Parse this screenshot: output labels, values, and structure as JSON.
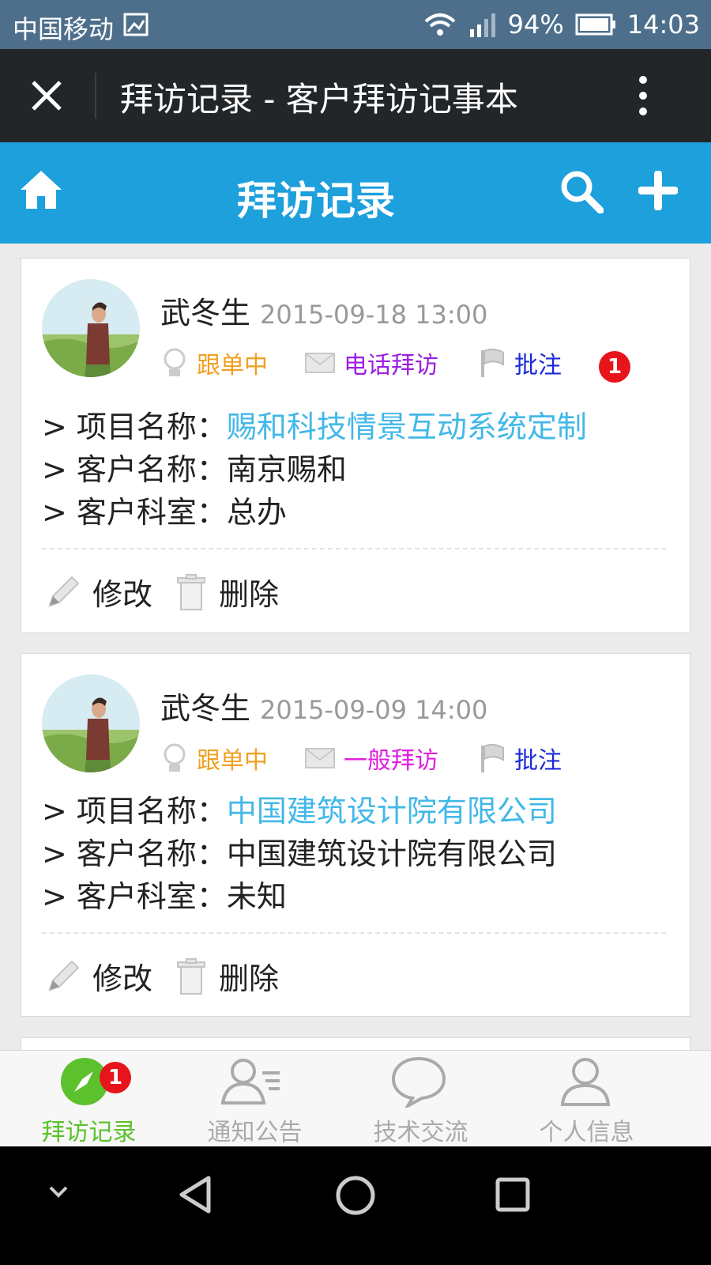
{
  "status_bar": {
    "carrier": "中国移动",
    "battery": "94%",
    "time": "14:03"
  },
  "top_bar": {
    "title": "拜访记录 - 客户拜访记事本"
  },
  "header": {
    "title": "拜访记录"
  },
  "records": [
    {
      "name": "武冬生",
      "date": "2015-09-18 13:00",
      "status": "跟单中",
      "visit_type": "电话拜访",
      "visit_type_color": "#9b1ee0",
      "annotate": "批注",
      "annotate_badge": "1",
      "fields": [
        {
          "label": "> 项目名称：",
          "value": "赐和科技情景互动系统定制"
        },
        {
          "label": "> 客户名称：",
          "value": "南京赐和"
        },
        {
          "label": "> 客户科室：",
          "value": "总办"
        }
      ],
      "edit_label": "修改",
      "delete_label": "删除"
    },
    {
      "name": "武冬生",
      "date": "2015-09-09 14:00",
      "status": "跟单中",
      "visit_type": "一般拜访",
      "visit_type_color": "#e020e0",
      "annotate": "批注",
      "fields": [
        {
          "label": "> 项目名称：",
          "value": "中国建筑设计院有限公司"
        },
        {
          "label": "> 客户名称：",
          "value": "中国建筑设计院有限公司"
        },
        {
          "label": "> 客户科室：",
          "value": "未知"
        }
      ],
      "edit_label": "修改",
      "delete_label": "删除"
    }
  ],
  "tab_bar": {
    "tabs": [
      {
        "label": "拜访记录",
        "icon": "compass-icon",
        "badge": "1",
        "active": true
      },
      {
        "label": "通知公告",
        "icon": "contact-list-icon"
      },
      {
        "label": "技术交流",
        "icon": "chat-bubble-icon"
      },
      {
        "label": "个人信息",
        "icon": "person-icon"
      }
    ]
  },
  "colors": {
    "header_blue": "#1da0dc",
    "status_orange": "#f0a020",
    "annotate_blue": "#1a2ad8",
    "link_blue": "#42b8e8",
    "tab_active_green": "#5cc12c",
    "badge_red": "#e8141c"
  }
}
